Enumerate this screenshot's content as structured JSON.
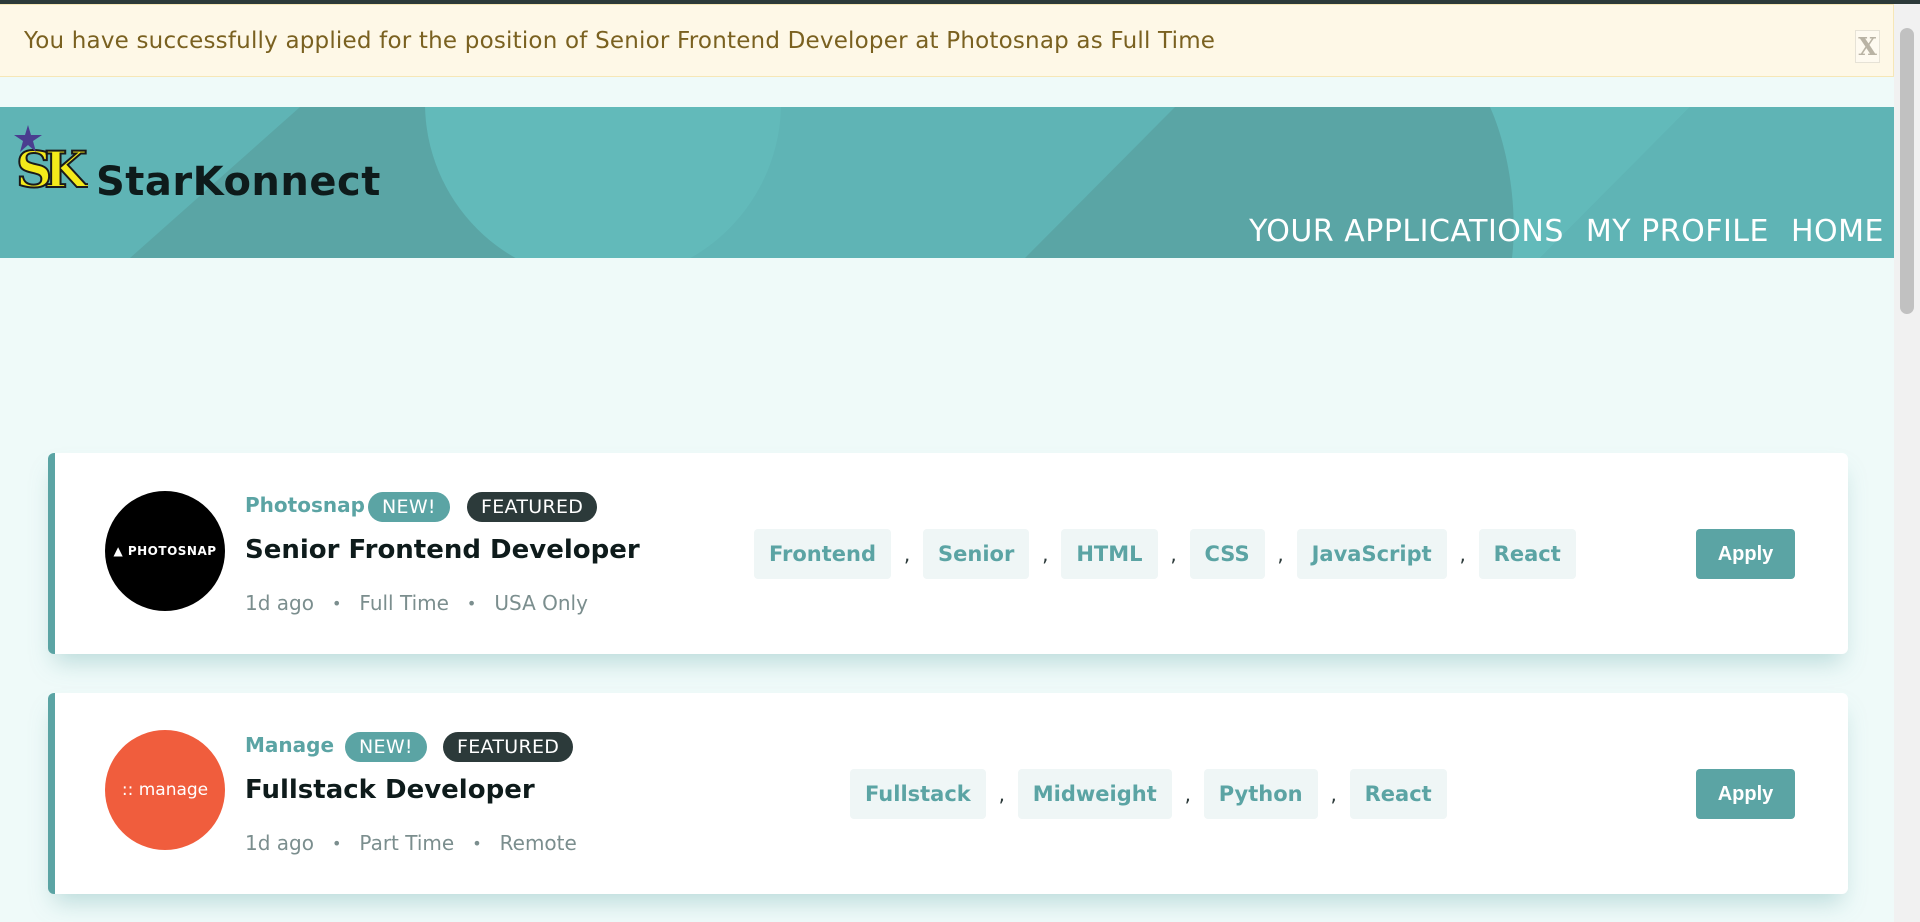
{
  "alert": {
    "message": "You have successfully applied for the position of Senior Frontend Developer at Photosnap as Full Time",
    "close_label": "X"
  },
  "brand": {
    "logo_text": "SK",
    "name": "StarKonnect"
  },
  "nav": {
    "items": [
      "YOUR APPLICATIONS",
      "MY PROFILE",
      "HOME"
    ]
  },
  "jobs": [
    {
      "company": "Photosnap",
      "logo_text": "▲ PHOTOSNAP",
      "badges": {
        "new": "NEW!",
        "featured": "FEATURED"
      },
      "position": "Senior Frontend Developer",
      "posted": "1d ago",
      "contract": "Full Time",
      "location": "USA Only",
      "tags": [
        "Frontend",
        "Senior",
        "HTML",
        "CSS",
        "JavaScript",
        "React"
      ],
      "apply_label": "Apply"
    },
    {
      "company": "Manage",
      "logo_text": ":: manage",
      "badges": {
        "new": "NEW!",
        "featured": "FEATURED"
      },
      "position": "Fullstack Developer",
      "posted": "1d ago",
      "contract": "Part Time",
      "location": "Remote",
      "tags": [
        "Fullstack",
        "Midweight",
        "Python",
        "React"
      ],
      "apply_label": "Apply"
    }
  ],
  "meta_separator": "•",
  "tag_separator": ",",
  "colors": {
    "primary": "#5ba4a4",
    "header_bg": "#5fb4b5",
    "page_bg": "#effaf9",
    "alert_bg": "#fef8e7",
    "alert_text": "#7a6120",
    "featured_badge": "#2c3a3a",
    "manage_logo": "#f05d3d"
  }
}
